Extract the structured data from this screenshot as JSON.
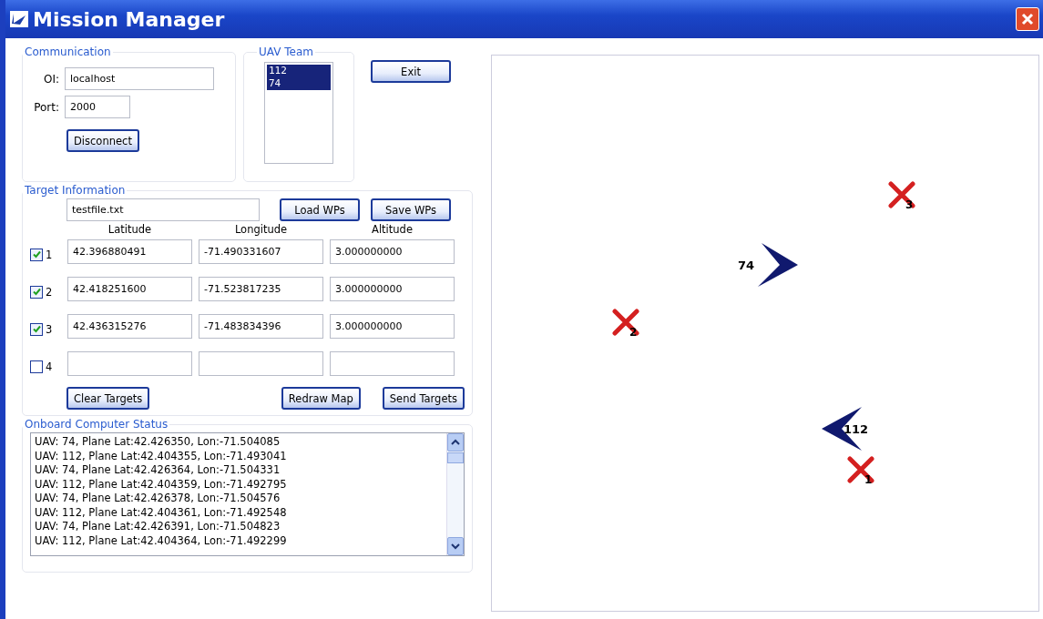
{
  "window": {
    "title": "Mission Manager"
  },
  "communication": {
    "title": "Communication",
    "oi_label": "OI:",
    "oi_value": "localhost",
    "port_label": "Port:",
    "port_value": "2000",
    "button": "Disconnect"
  },
  "uav_team": {
    "title": "UAV Team",
    "items": [
      {
        "label": "112",
        "selected": true
      },
      {
        "label": "74",
        "selected": true
      }
    ]
  },
  "exit_button": "Exit",
  "target_information": {
    "title": "Target Information",
    "file": "testfile.txt",
    "load_button": "Load WPs",
    "save_button": "Save WPs",
    "columns": [
      "Latitude",
      "Longitude",
      "Altitude"
    ],
    "rows": [
      {
        "label": "1",
        "checked": true,
        "latitude": "42.396880491",
        "longitude": "-71.490331607",
        "altitude": "3.000000000"
      },
      {
        "label": "2",
        "checked": true,
        "latitude": "42.418251600",
        "longitude": "-71.523817235",
        "altitude": "3.000000000"
      },
      {
        "label": "3",
        "checked": true,
        "latitude": "42.436315276",
        "longitude": "-71.483834396",
        "altitude": "3.000000000"
      },
      {
        "label": "4",
        "checked": false
      }
    ],
    "clear_button": "Clear Targets",
    "redraw_button": "Redraw Map",
    "send_button": "Send Targets"
  },
  "status": {
    "title": "Onboard Computer Status",
    "lines": [
      "UAV: 74, Plane Lat:42.426350, Lon:-71.504085",
      "UAV: 112, Plane Lat:42.404355, Lon:-71.493041",
      "UAV: 74, Plane Lat:42.426364, Lon:-71.504331",
      "UAV: 112, Plane Lat:42.404359, Lon:-71.492795",
      "UAV: 74, Plane Lat:42.426378, Lon:-71.504576",
      "UAV: 112, Plane Lat:42.404361, Lon:-71.492548",
      "UAV: 74, Plane Lat:42.426391, Lon:-71.504823",
      "UAV: 112, Plane Lat:42.404364, Lon:-71.492299"
    ]
  },
  "map": {
    "markers": [
      {
        "kind": "target",
        "label": "3"
      },
      {
        "kind": "uav",
        "label": "74",
        "facing_left": false
      },
      {
        "kind": "target",
        "label": "2"
      },
      {
        "kind": "uav",
        "label": "112",
        "facing_left": true
      },
      {
        "kind": "target",
        "label": "1"
      }
    ]
  }
}
